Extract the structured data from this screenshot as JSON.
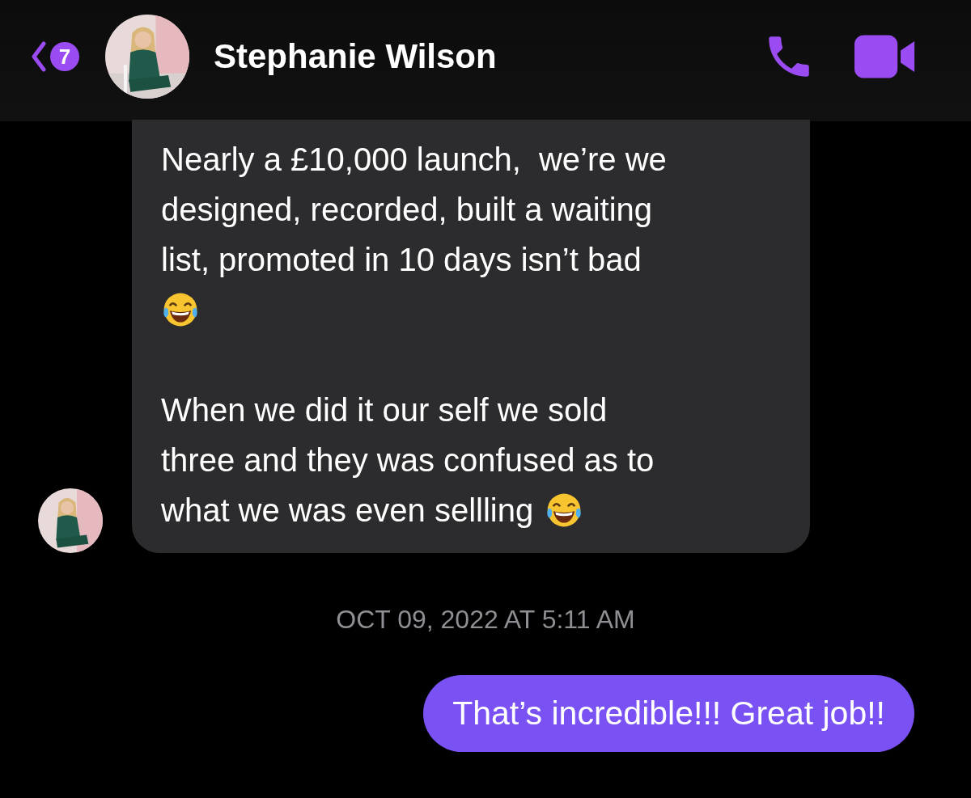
{
  "header": {
    "unread_count": "7",
    "contact_name": "Stephanie Wilson"
  },
  "messages": [
    {
      "kind": "incoming",
      "paragraphs": [
        [
          [
            {
              "kind": "text",
              "text": "Nearly a £10,000 launch,  we’re we\ndesigned, recorded, built a waiting\nlist, promoted in 10 days isn’t bad"
            }
          ],
          [
            {
              "kind": "emoji"
            }
          ]
        ],
        [
          [
            {
              "kind": "text",
              "text": "When we did it our self we sold\nthree and they was confused as to"
            }
          ],
          [
            {
              "kind": "text",
              "text": "what we was even sellling"
            },
            {
              "kind": "emoji"
            }
          ]
        ]
      ]
    },
    {
      "kind": "timestamp",
      "text": "OCT 09, 2022 AT 5:11 AM"
    },
    {
      "kind": "outgoing",
      "text": "That’s incredible!!! Great job!!"
    }
  ]
}
